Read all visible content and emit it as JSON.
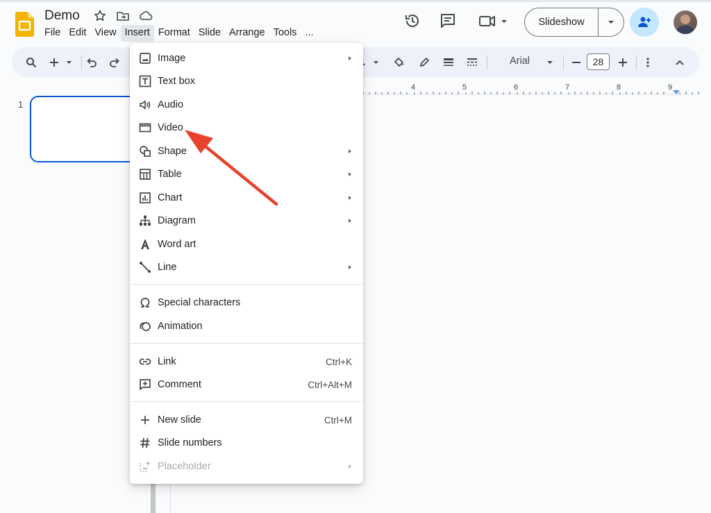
{
  "app": {
    "icon": "slides-logo-icon",
    "brand_color": "#f4b400"
  },
  "document": {
    "title": "Demo"
  },
  "menubar": [
    "File",
    "Edit",
    "View",
    "Insert",
    "Format",
    "Slide",
    "Arrange",
    "Tools",
    "..."
  ],
  "active_menu": "Insert",
  "header": {
    "slideshow_label": "Slideshow"
  },
  "toolbar": {
    "font": "Arial",
    "font_size": "28"
  },
  "slides": {
    "current_number": "1"
  },
  "ruler": {
    "labels": [
      "4",
      "5",
      "6",
      "7",
      "8",
      "9"
    ]
  },
  "insert_menu": {
    "groups": [
      [
        {
          "label": "Image",
          "icon": "image-icon",
          "submenu": true
        },
        {
          "label": "Text box",
          "icon": "text-box-icon",
          "submenu": false
        },
        {
          "label": "Audio",
          "icon": "audio-icon",
          "submenu": false
        },
        {
          "label": "Video",
          "icon": "video-icon",
          "submenu": false
        },
        {
          "label": "Shape",
          "icon": "shape-icon",
          "submenu": true
        },
        {
          "label": "Table",
          "icon": "table-icon",
          "submenu": true
        },
        {
          "label": "Chart",
          "icon": "chart-icon",
          "submenu": true
        },
        {
          "label": "Diagram",
          "icon": "diagram-icon",
          "submenu": true
        },
        {
          "label": "Word art",
          "icon": "word-art-icon",
          "submenu": false
        },
        {
          "label": "Line",
          "icon": "line-icon",
          "submenu": true
        }
      ],
      [
        {
          "label": "Special characters",
          "icon": "omega-icon",
          "submenu": false
        },
        {
          "label": "Animation",
          "icon": "animation-icon",
          "submenu": false
        }
      ],
      [
        {
          "label": "Link",
          "icon": "link-icon",
          "shortcut": "Ctrl+K"
        },
        {
          "label": "Comment",
          "icon": "comment-add-icon",
          "shortcut": "Ctrl+Alt+M"
        }
      ],
      [
        {
          "label": "New slide",
          "icon": "plus-icon",
          "shortcut": "Ctrl+M"
        },
        {
          "label": "Slide numbers",
          "icon": "hash-icon",
          "submenu": false
        },
        {
          "label": "Placeholder",
          "icon": "placeholder-icon",
          "submenu": true,
          "disabled": true
        }
      ]
    ]
  },
  "annotation": {
    "color": "#e8412c",
    "target": "Video"
  }
}
